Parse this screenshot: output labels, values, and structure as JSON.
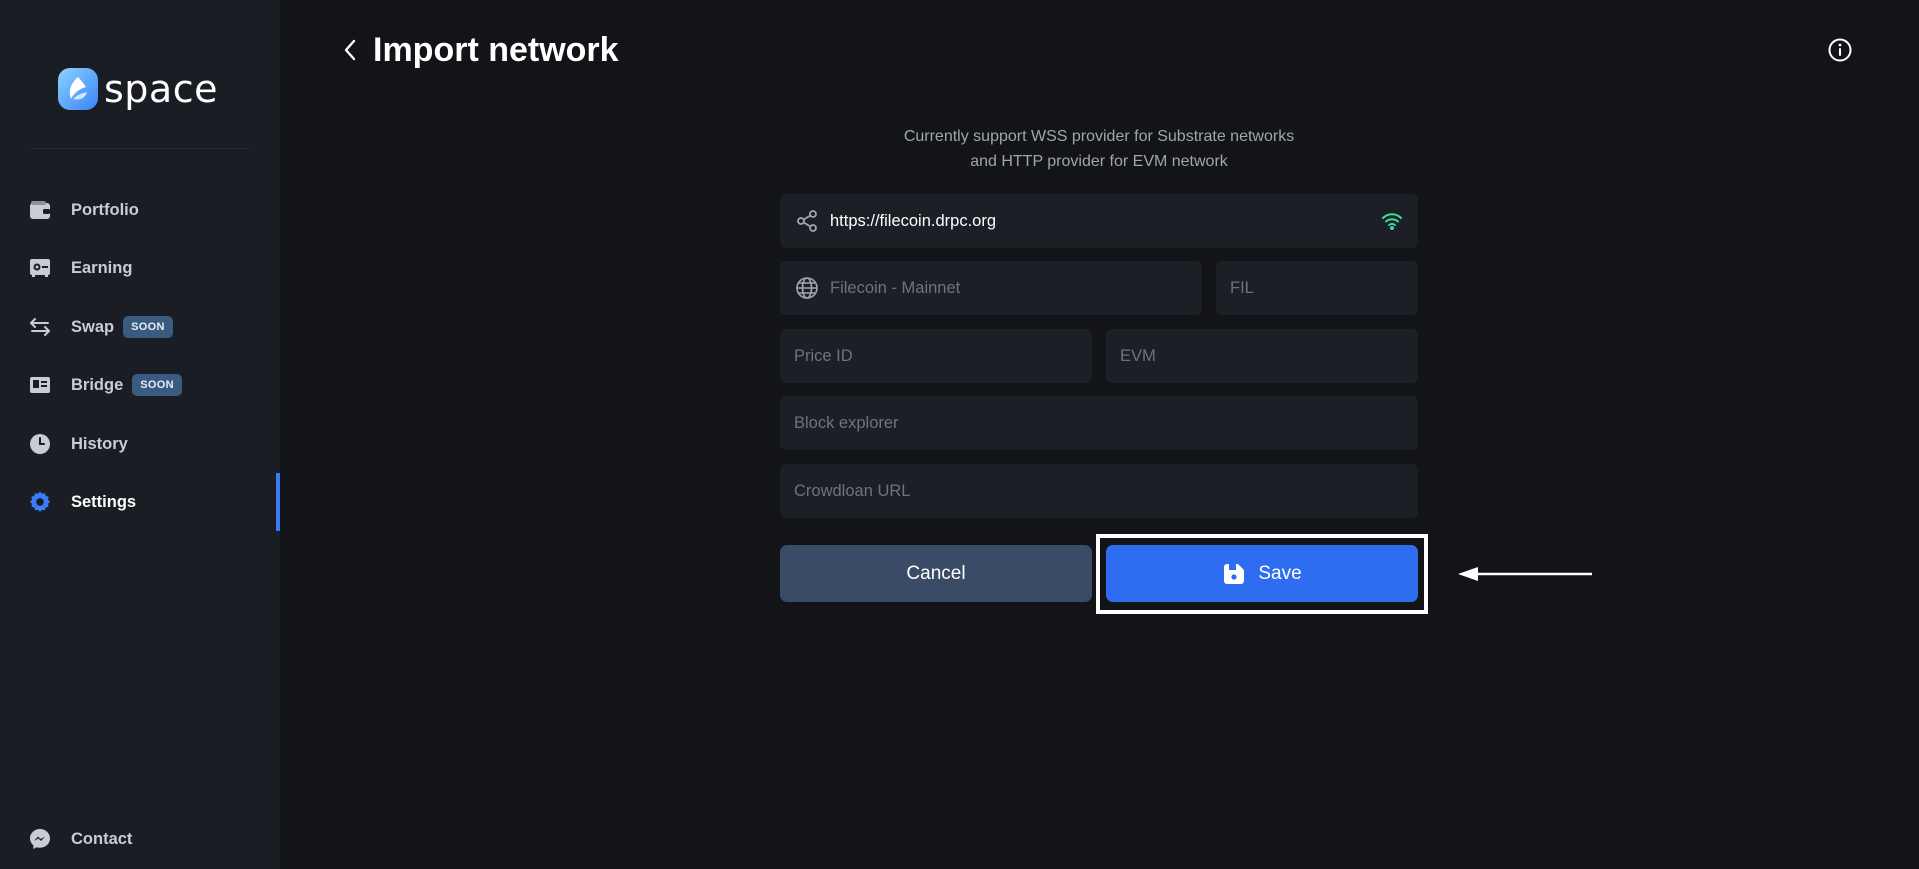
{
  "app": {
    "logo_text": "space"
  },
  "sidebar": {
    "items": [
      {
        "label": "Portfolio",
        "icon": "wallet-icon"
      },
      {
        "label": "Earning",
        "icon": "safe-icon"
      },
      {
        "label": "Swap",
        "icon": "swap-arrows-icon",
        "badge": "SOON"
      },
      {
        "label": "Bridge",
        "icon": "bridge-card-icon",
        "badge": "SOON"
      },
      {
        "label": "History",
        "icon": "clock-icon"
      },
      {
        "label": "Settings",
        "icon": "gear-icon",
        "active": true
      }
    ],
    "contact": {
      "label": "Contact",
      "icon": "messenger-icon"
    }
  },
  "header": {
    "title": "Import network"
  },
  "form": {
    "support_line1": "Currently support WSS provider for Substrate networks",
    "support_line2": "and HTTP provider for EVM network",
    "provider_url": "https://filecoin.drpc.org",
    "network_name_placeholder": "Filecoin - Mainnet",
    "symbol_placeholder": "FIL",
    "price_id_placeholder": "Price ID",
    "network_type_placeholder": "EVM",
    "block_explorer_placeholder": "Block explorer",
    "crowdloan_url_placeholder": "Crowdloan URL",
    "cancel_label": "Cancel",
    "save_label": "Save"
  },
  "colors": {
    "accent": "#2f6df0",
    "sidebar_bg": "#1a1d23",
    "page_bg": "#131418",
    "field_bg": "#1c1f26",
    "connected": "#3ddc97"
  }
}
